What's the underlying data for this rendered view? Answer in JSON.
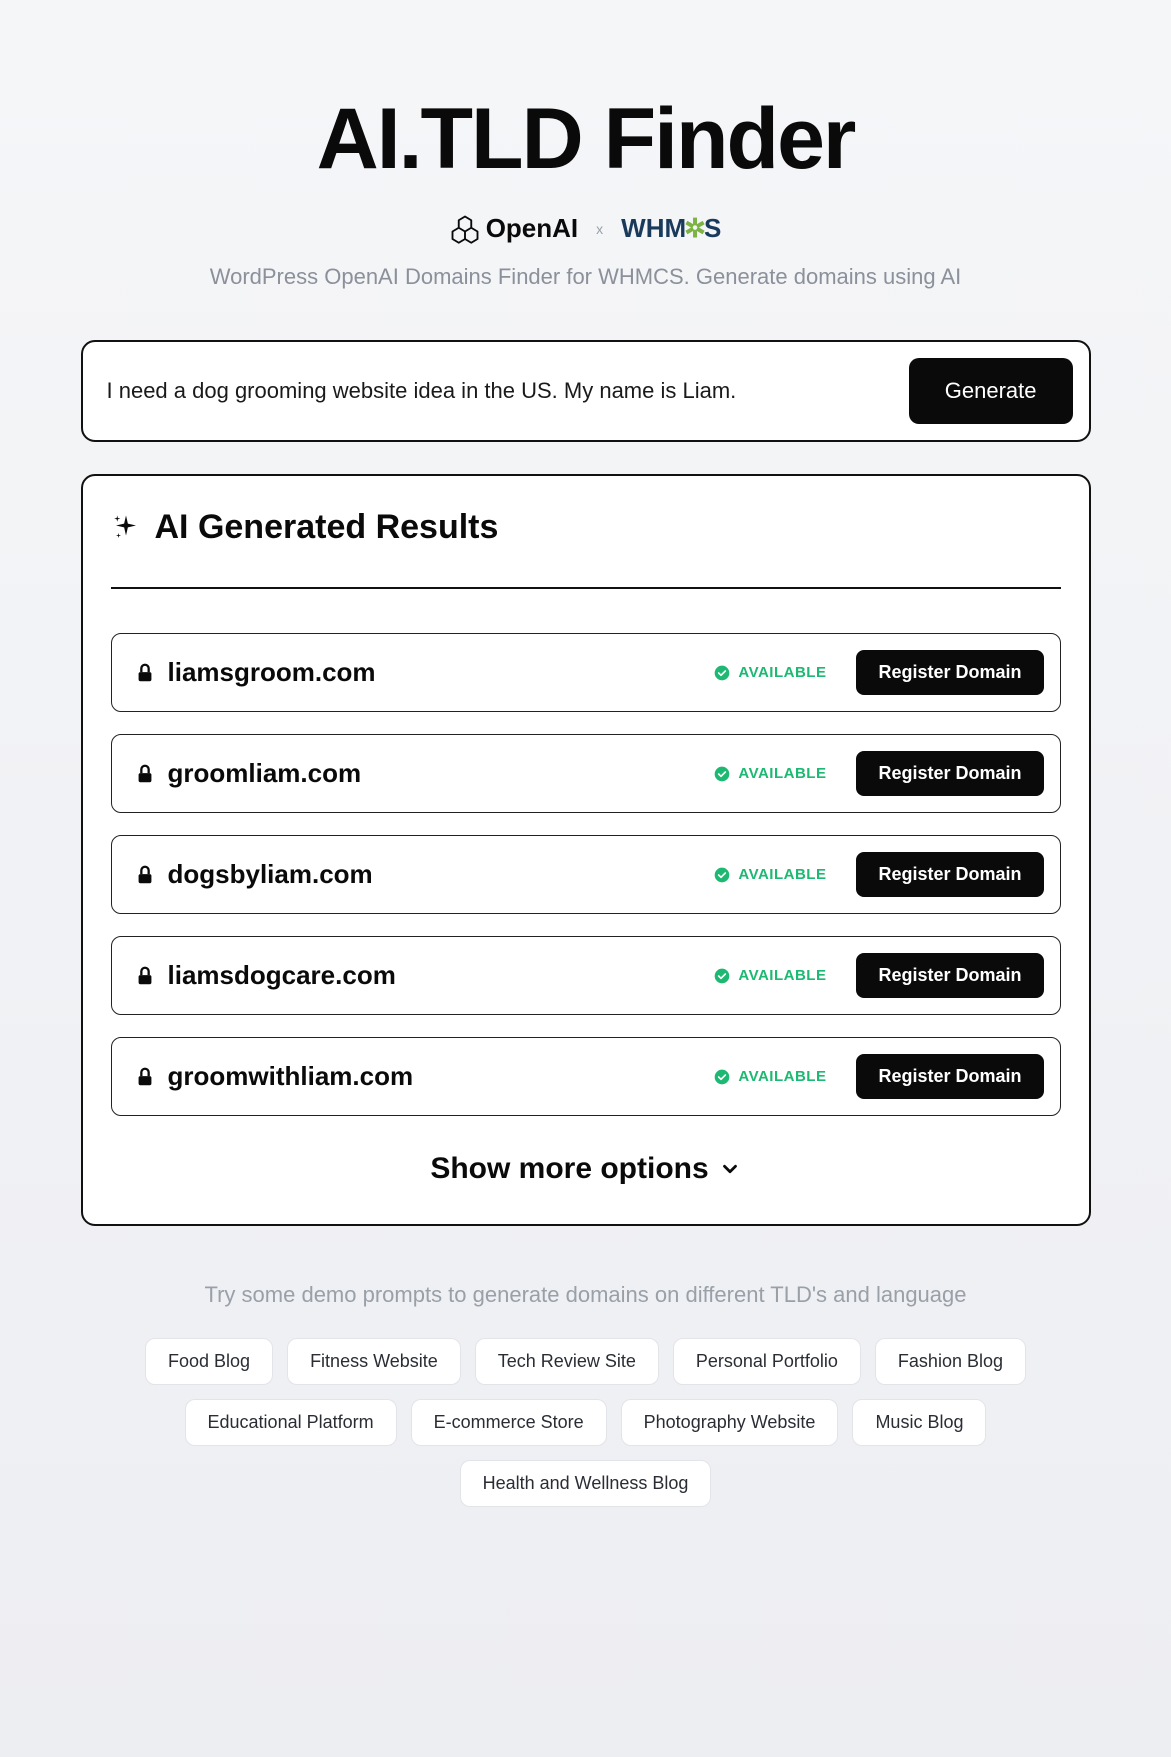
{
  "header": {
    "title": "AI.TLD Finder",
    "openai_label": "OpenAI",
    "separator": "x",
    "whmcs_prefix": "WHM",
    "whmcs_suffix": "S",
    "subtitle": "WordPress OpenAI Domains Finder for WHMCS. Generate domains using AI"
  },
  "search": {
    "value": "I need a dog grooming website idea in the US. My name is Liam.",
    "button": "Generate"
  },
  "results": {
    "title": "AI Generated Results",
    "status_label": "AVAILABLE",
    "register_label": "Register Domain",
    "show_more": "Show more options",
    "items": [
      {
        "domain": "liamsgroom.com"
      },
      {
        "domain": "groomliam.com"
      },
      {
        "domain": "dogsbyliam.com"
      },
      {
        "domain": "liamsdogcare.com"
      },
      {
        "domain": "groomwithliam.com"
      }
    ]
  },
  "demo": {
    "hint": "Try some demo prompts to generate domains on different TLD's and language",
    "chips": [
      "Food Blog",
      "Fitness Website",
      "Tech Review Site",
      "Personal Portfolio",
      "Fashion Blog",
      "Educational Platform",
      "E-commerce Store",
      "Photography Website",
      "Music Blog",
      "Health and Wellness Blog"
    ]
  }
}
